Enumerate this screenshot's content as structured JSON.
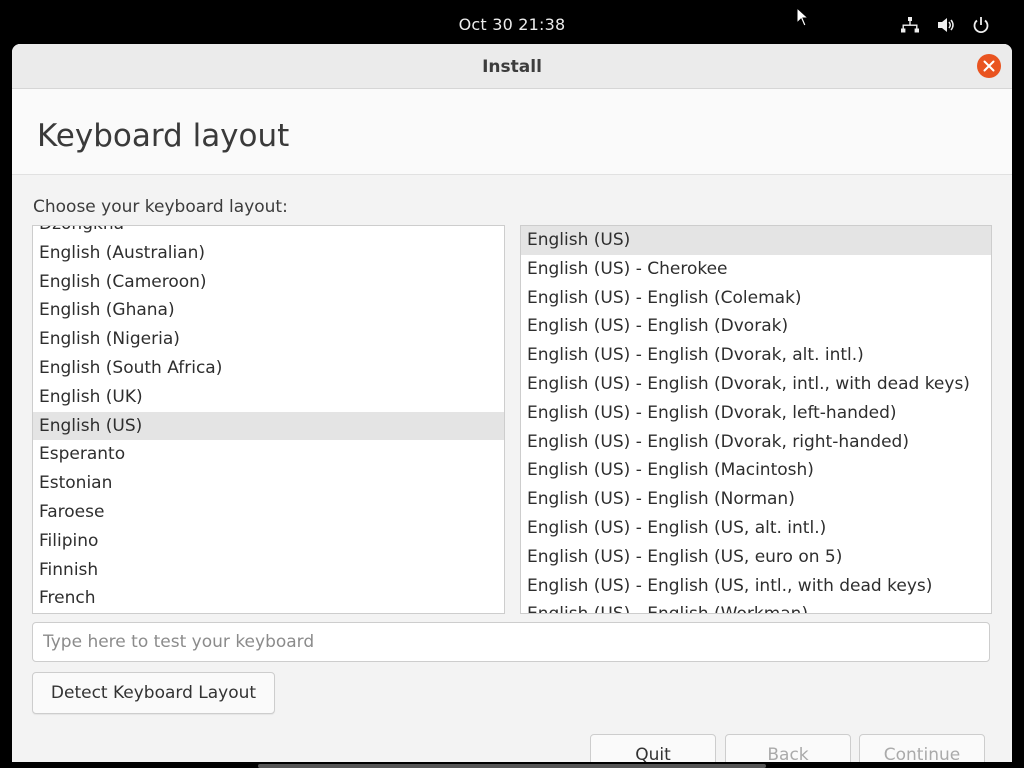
{
  "topbar": {
    "datetime": "Oct 30  21:38",
    "icons": [
      "network-icon",
      "volume-icon",
      "power-icon"
    ]
  },
  "window": {
    "title": "Install",
    "close_icon": "close-icon",
    "accent": "#e95420"
  },
  "page": {
    "title": "Keyboard layout",
    "choose_label": "Choose your keyboard layout:"
  },
  "layouts": {
    "items": [
      "Dzongkha",
      "English (Australian)",
      "English (Cameroon)",
      "English (Ghana)",
      "English (Nigeria)",
      "English (South Africa)",
      "English (UK)",
      "English (US)",
      "Esperanto",
      "Estonian",
      "Faroese",
      "Filipino",
      "Finnish",
      "French"
    ],
    "selected": "English (US)"
  },
  "variants": {
    "items": [
      "English (US)",
      "English (US) - Cherokee",
      "English (US) - English (Colemak)",
      "English (US) - English (Dvorak)",
      "English (US) - English (Dvorak, alt. intl.)",
      "English (US) - English (Dvorak, intl., with dead keys)",
      "English (US) - English (Dvorak, left-handed)",
      "English (US) - English (Dvorak, right-handed)",
      "English (US) - English (Macintosh)",
      "English (US) - English (Norman)",
      "English (US) - English (US, alt. intl.)",
      "English (US) - English (US, euro on 5)",
      "English (US) - English (US, intl., with dead keys)",
      "English (US) - English (Workman)"
    ],
    "selected": "English (US)"
  },
  "test_input": {
    "placeholder": "Type here to test your keyboard",
    "value": ""
  },
  "buttons": {
    "detect": "Detect Keyboard Layout",
    "quit": "Quit",
    "back": "Back",
    "continue": "Continue"
  }
}
